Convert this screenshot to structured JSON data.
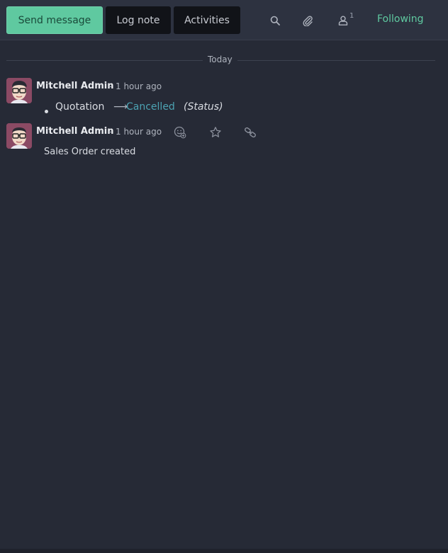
{
  "composer": {
    "send_message_label": "Send message",
    "log_note_label": "Log note",
    "activities_label": "Activities"
  },
  "toolbar": {
    "search_icon": "search-icon",
    "attachment_icon": "paperclip-icon",
    "followers_icon": "user-icon",
    "followers_count": "1",
    "following_label": "Following"
  },
  "timeline": {
    "date_separator": "Today"
  },
  "messages": [
    {
      "author": "Mitchell Admin",
      "separator": "-",
      "time": "1 hour ago",
      "tracking": {
        "field": "Quotation",
        "arrow": "⟶",
        "new_value": "Cancelled",
        "field_label": "(Status)"
      }
    },
    {
      "author": "Mitchell Admin",
      "separator": "-",
      "time": "1 hour ago",
      "body": "Sales Order created",
      "actions": [
        "add-reaction-icon",
        "star-icon",
        "link-icon"
      ]
    }
  ],
  "colors": {
    "accent": "#5fc9a0",
    "link": "#4ca3b3",
    "background": "#262a36",
    "topbar": "#2d3240"
  }
}
